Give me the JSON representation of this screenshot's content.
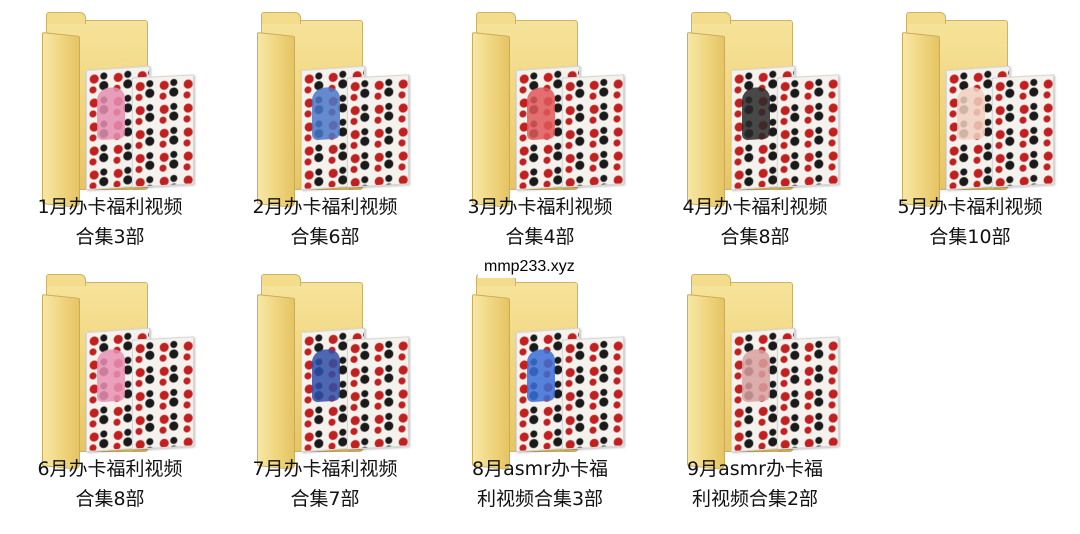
{
  "folders": [
    {
      "label": "1月办卡福利视频\n合集3部",
      "accent": "#e58fb2"
    },
    {
      "label": "2月办卡福利视频\n合集6部",
      "accent": "#4a78c9"
    },
    {
      "label": "3月办卡福利视频\n合集4部",
      "accent": "#e0585a"
    },
    {
      "label": "4月办卡福利视频\n合集8部",
      "accent": "#2a2a2a"
    },
    {
      "label": "5月办卡福利视频\n合集10部",
      "accent": "#f0d0c0"
    },
    {
      "label": "6月办卡福利视频\n合集8部",
      "accent": "#e890b4"
    },
    {
      "label": "7月办卡福利视频\n合集7部",
      "accent": "#2f4fa8"
    },
    {
      "label": "8月asmr办卡福\n利视频合集3部",
      "accent": "#3a6fd8"
    },
    {
      "label": "9月asmr办卡福\n利视频合集2部",
      "accent": "#d8a0a0"
    }
  ],
  "watermark": "mmp233.xyz",
  "icon": "folder-icon"
}
